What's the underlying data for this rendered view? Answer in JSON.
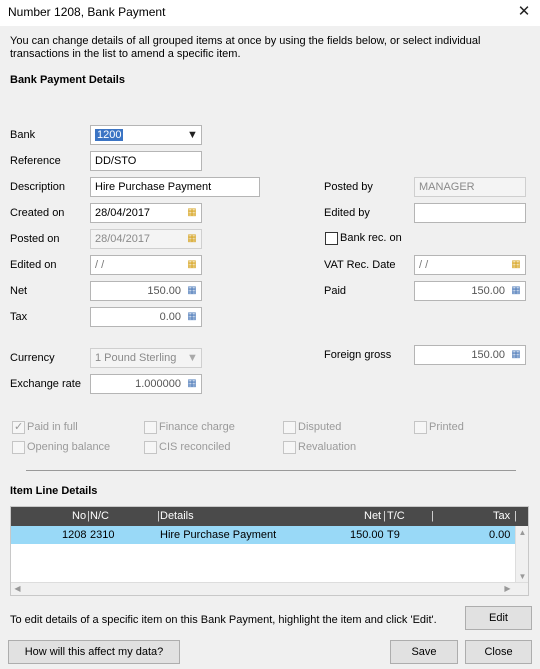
{
  "window": {
    "title": "Number 1208, Bank Payment",
    "close_symbol": "✕"
  },
  "intro": "You can change details of all grouped items at once by using the fields below, or select individual transactions in the list to amend a specific item.",
  "section_bank": "Bank Payment Details",
  "fields": {
    "bank": {
      "label": "Bank",
      "value": "1200"
    },
    "reference": {
      "label": "Reference",
      "value": "DD/STO"
    },
    "description": {
      "label": "Description",
      "value": "Hire Purchase Payment"
    },
    "created_on": {
      "label": "Created on",
      "value": "28/04/2017"
    },
    "posted_on": {
      "label": "Posted on",
      "value": "28/04/2017"
    },
    "edited_on": {
      "label": "Edited on",
      "value": " / /"
    },
    "net": {
      "label": "Net",
      "value": "150.00"
    },
    "tax": {
      "label": "Tax",
      "value": "0.00"
    },
    "currency": {
      "label": "Currency",
      "value": "1  Pound Sterling"
    },
    "exchange_rate": {
      "label": "Exchange rate",
      "value": "1.000000"
    },
    "posted_by": {
      "label": "Posted by",
      "value": "MANAGER"
    },
    "edited_by": {
      "label": "Edited by",
      "value": ""
    },
    "bank_rec_on": {
      "label": "Bank rec. on"
    },
    "vat_rec_date": {
      "label": "VAT Rec. Date",
      "value": " / /"
    },
    "paid": {
      "label": "Paid",
      "value": "150.00"
    },
    "foreign_gross": {
      "label": "Foreign gross",
      "value": "150.00"
    }
  },
  "checkboxes": {
    "paid_in_full": {
      "label": "Paid in full",
      "checked": true
    },
    "finance_charge": {
      "label": "Finance charge",
      "checked": false
    },
    "disputed": {
      "label": "Disputed",
      "checked": false
    },
    "printed": {
      "label": "Printed",
      "checked": false
    },
    "opening_balance": {
      "label": "Opening balance",
      "checked": false
    },
    "cis_reconciled": {
      "label": "CIS reconciled",
      "checked": false
    },
    "revaluation": {
      "label": "Revaluation",
      "checked": false
    }
  },
  "section_items": "Item Line Details",
  "grid": {
    "columns": [
      "No",
      "N/C",
      "Details",
      "Net",
      "T/C",
      "Tax"
    ],
    "rows": [
      {
        "no": "1208",
        "nc": "2310",
        "details": "Hire Purchase Payment",
        "net": "150.00",
        "tc": "T9",
        "tax": "0.00"
      }
    ]
  },
  "edit_hint": "To edit details of a specific item on this Bank Payment, highlight the item and click 'Edit'.",
  "buttons": {
    "edit": "Edit",
    "affect": "How will this affect my data?",
    "save": "Save",
    "close": "Close"
  },
  "icons": {
    "calendar": "calendar-icon",
    "calculator": "calculator-icon",
    "dropdown": "chevron-down-icon"
  },
  "colors": {
    "selected_row": "#99d9f7",
    "grid_header": "#4a4a4a",
    "selection_highlight": "#3b74c4"
  }
}
